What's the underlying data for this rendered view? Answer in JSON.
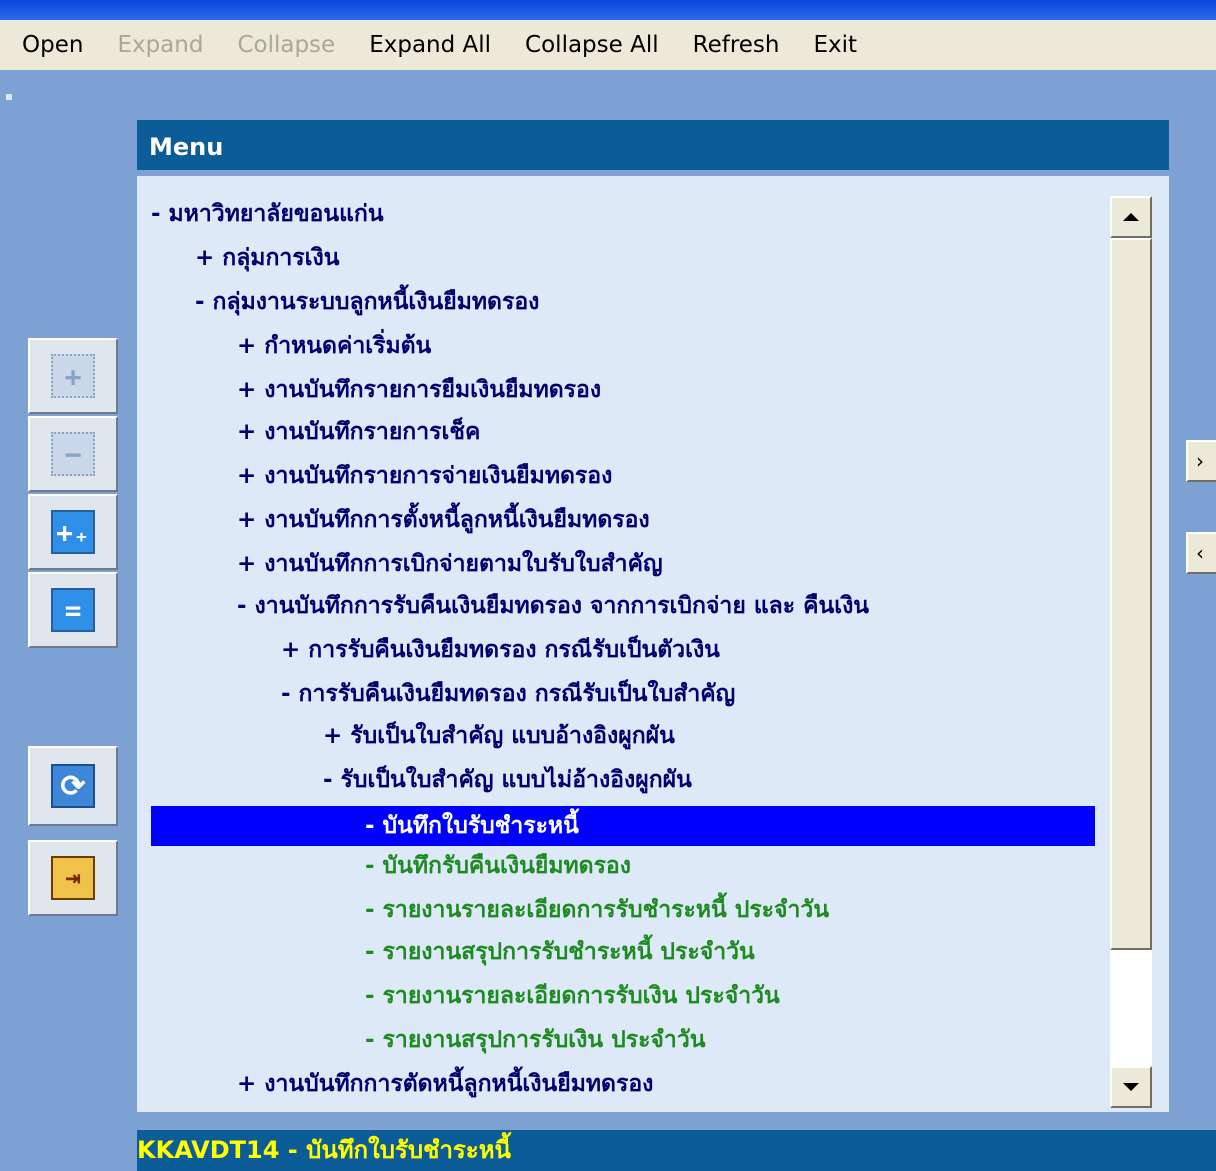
{
  "menubar": {
    "open": "Open",
    "expand": "Expand",
    "collapse": "Collapse",
    "expand_all": "Expand All",
    "collapse_all": "Collapse All",
    "refresh": "Refresh",
    "exit": "Exit"
  },
  "panel": {
    "title": "Menu"
  },
  "tree": {
    "items": [
      {
        "text": "- มหาวิทยาลัยขอนแก่น"
      },
      {
        "text": "+ กลุ่มการเงิน"
      },
      {
        "text": "- กลุ่มงานระบบลูกหนี้เงินยืมทดรอง"
      },
      {
        "text": "+ กำหนดค่าเริ่มต้น"
      },
      {
        "text": "+ งานบันทึกรายการยืมเงินยืมทดรอง"
      },
      {
        "text": "+ งานบันทึกรายการเช็ค"
      },
      {
        "text": "+ งานบันทึกรายการจ่ายเงินยืมทดรอง"
      },
      {
        "text": "+ งานบันทึกการตั้งหนี้ลูกหนี้เงินยืมทดรอง"
      },
      {
        "text": "+ งานบันทึกการเบิกจ่ายตามใบรับใบสำคัญ"
      },
      {
        "text": "- งานบันทึกการรับคืนเงินยืมทดรอง จากการเบิกจ่าย และ คืนเงิน"
      },
      {
        "text": "+ การรับคืนเงินยืมทดรอง กรณีรับเป็นตัวเงิน"
      },
      {
        "text": "- การรับคืนเงินยืมทดรอง กรณีรับเป็นใบสำคัญ"
      },
      {
        "text": "+ รับเป็นใบสำคัญ แบบอ้างอิงผูกผัน"
      },
      {
        "text": "- รับเป็นใบสำคัญ แบบไม่อ้างอิงผูกผัน"
      },
      {
        "text": "- บันทึกใบรับชำระหนี้",
        "selected": true
      },
      {
        "text": "- บันทึกรับคืนเงินยืมทดรอง"
      },
      {
        "text": "- รายงานรายละเอียดการรับชำระหนี้ ประจำวัน"
      },
      {
        "text": "- รายงานสรุปการรับชำระหนี้ ประจำวัน"
      },
      {
        "text": "- รายงานรายละเอียดการรับเงิน ประจำวัน"
      },
      {
        "text": "- รายงานสรุปการรับเงิน ประจำวัน"
      },
      {
        "text": "+ งานบันทึกการตัดหนี้ลูกหนี้เงินยืมทดรอง"
      }
    ]
  },
  "statusbar": {
    "text": "KKAVDT14 - บันทึกใบรับชำระหนี้"
  },
  "toolbar_icons": {
    "expand": "+",
    "collapse": "−",
    "expand_all": "+₊",
    "collapse_all": "=",
    "refresh": "⟳",
    "exit": "⇥"
  },
  "side_buttons": {
    "forward": "›",
    "back": "‹"
  },
  "colors": {
    "background": "#7ea1d4",
    "header": "#0b5c97",
    "tree_bg": "#dde9f6",
    "node_text": "#00006e",
    "leaf_text": "#1e8a22",
    "selection": "#0000ff",
    "status_text": "#ffff00"
  }
}
